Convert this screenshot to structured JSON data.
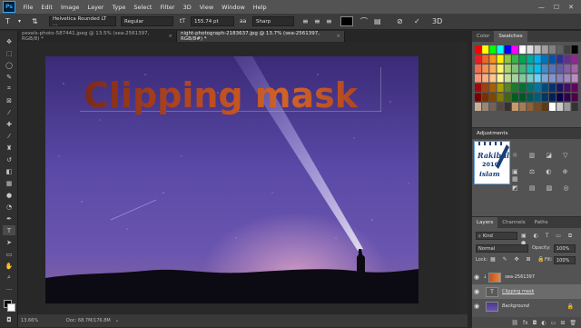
{
  "app": {
    "logo": "Ps"
  },
  "menu": [
    "File",
    "Edit",
    "Image",
    "Layer",
    "Type",
    "Select",
    "Filter",
    "3D",
    "View",
    "Window",
    "Help"
  ],
  "window_controls": {
    "minimize": "—",
    "maximize": "☐",
    "close": "✕"
  },
  "options": {
    "font_family": "Helvetica Rounded LT ...",
    "font_style": "Regular",
    "font_size": "155.74 pt",
    "antialias": "Sharp",
    "text_color": "#000000"
  },
  "tabs": [
    {
      "label": "pexels-photo-587441.jpeg @ 13.5% (sea-2561397, RGB/8) *",
      "close": "×",
      "active": false
    },
    {
      "label": "night-photograph-2183637.jpg @ 13.7% (sea-2561397, RGB/8#) *",
      "close": "×",
      "active": true
    }
  ],
  "canvas": {
    "clipping_text": "Clipping mask"
  },
  "status": {
    "zoom": "13.66%",
    "doc": "Doc: 68.7M/176.8M"
  },
  "panels": {
    "color_tab": "Color",
    "swatches_tab": "Swatches",
    "adjustments_title": "Adjustments",
    "layers_tab": "Layers",
    "channels_tab": "Channels",
    "paths_tab": "Paths",
    "kind_label": "Kind",
    "blend_mode": "Normal",
    "opacity_label": "Opacity:",
    "opacity_value": "100%",
    "lock_label": "Lock:",
    "fill_label": "Fill:",
    "fill_value": "100%"
  },
  "layers": [
    {
      "name": "sea-2561397",
      "clipped": true
    },
    {
      "name": "Clipping mask",
      "type": "text",
      "selected": true
    },
    {
      "name": "Background",
      "locked": true
    }
  ],
  "watermark": {
    "line1": "Rakibul",
    "line2": "2010",
    "line3": "islam"
  },
  "colors": {
    "accent": "#31a8ff",
    "menu_bg": "#535353",
    "canvas_bg": "#282828"
  }
}
